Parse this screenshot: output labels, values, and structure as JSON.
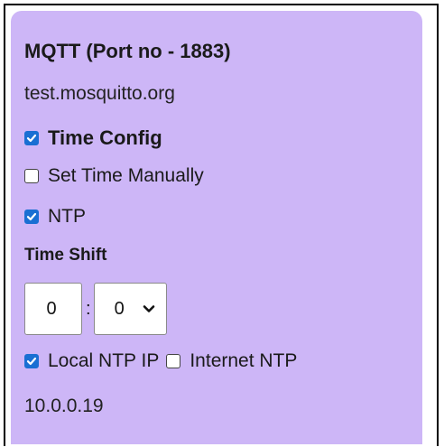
{
  "mqtt": {
    "title": "MQTT (Port no - 1883)",
    "host": "test.mosquitto.org"
  },
  "time_config": {
    "label": "Time Config",
    "checked": true
  },
  "set_time_manually": {
    "label": "Set Time Manually",
    "checked": false
  },
  "ntp": {
    "label": "NTP",
    "checked": true
  },
  "time_shift": {
    "title": "Time Shift",
    "hours_value": "0",
    "separator": ":",
    "minutes_value": "0"
  },
  "ntp_source": {
    "local_label": "Local NTP IP",
    "local_checked": true,
    "internet_label": "Internet NTP",
    "internet_checked": false
  },
  "ntp_ip": "10.0.0.19",
  "colors": {
    "card_background": "#cdb6f7",
    "checkbox_accent": "#1a6fd3"
  }
}
